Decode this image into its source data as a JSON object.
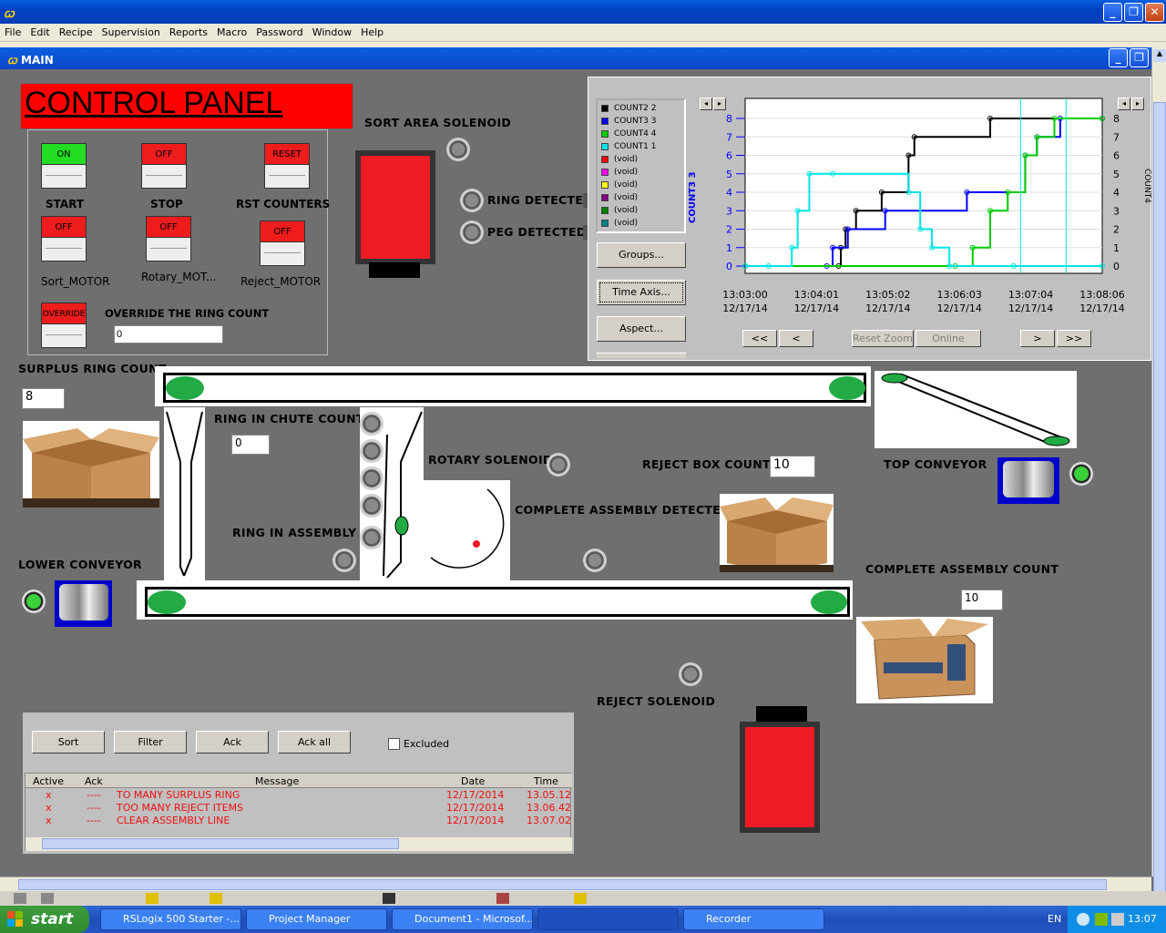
{
  "window": {
    "minimize": "_",
    "restore": "❐",
    "close": "✕"
  },
  "menu": [
    "File",
    "Edit",
    "Recipe",
    "Supervision",
    "Reports",
    "Macro",
    "Password",
    "Window",
    "Help"
  ],
  "child_window": {
    "title": "MAIN",
    "minimize": "_",
    "restore": "❐"
  },
  "control_panel": {
    "title": "CONTROL PANEL",
    "buttons": [
      {
        "state": "ON",
        "label": "START",
        "color": "#22dd22"
      },
      {
        "state": "OFF",
        "label": "STOP",
        "color": "#ee1c1c"
      },
      {
        "state": "RESET",
        "label": "RST COUNTERS",
        "color": "#ee1c1c"
      },
      {
        "state": "OFF",
        "label": "Sort_MOTOR",
        "color": "#ee1c1c"
      },
      {
        "state": "OFF",
        "label": "Rotary_MOT...",
        "color": "#ee1c1c"
      },
      {
        "state": "OFF",
        "label": "Reject_MOTOR",
        "color": "#ee1c1c"
      },
      {
        "state": "OVERRIDE",
        "label": "",
        "color": "#ee1c1c"
      }
    ],
    "override_label": "OVERRIDE THE RING COUNT",
    "override_value": "0"
  },
  "labels": {
    "sort_area_solenoid": "SORT AREA SOLENOID",
    "ring_detected": "RING DETECTED",
    "peg_detected": "PEG DETECTED",
    "surplus_ring_count": "SURPLUS RING COUNT",
    "ring_in_chute_count": "RING IN CHUTE COUNT",
    "rotary_solenoid": "ROTARY SOLENOID",
    "reject_box_count": "REJECT BOX COUNT",
    "top_conveyor": "TOP CONVEYOR",
    "complete_assembly_detected": "COMPLETE ASSEMBLY DETECTED",
    "ring_in_assembly": "RING IN ASSEMBLY",
    "lower_conveyor": "LOWER CONVEYOR",
    "complete_assembly_count": "COMPLETE ASSEMBLY COUNT",
    "reject_solenoid": "REJECT SOLENOID"
  },
  "values": {
    "surplus_ring_count": "8",
    "ring_in_chute_count": "0",
    "reject_box_count": "10",
    "complete_assembly_count": "10"
  },
  "trend": {
    "legend": [
      {
        "name": "COUNT2 2",
        "color": "#000000"
      },
      {
        "name": "COUNT3 3",
        "color": "#0000ff"
      },
      {
        "name": "COUNT4 4",
        "color": "#00cc00"
      },
      {
        "name": "COUNT1 1",
        "color": "#00e5e5"
      },
      {
        "name": "(void)",
        "color": "#ff0000"
      },
      {
        "name": "(void)",
        "color": "#ff00ff"
      },
      {
        "name": "(void)",
        "color": "#ffff00"
      },
      {
        "name": "(void)",
        "color": "#800080"
      },
      {
        "name": "(void)",
        "color": "#008000"
      },
      {
        "name": "(void)",
        "color": "#008080"
      }
    ],
    "buttons": {
      "groups": "Groups...",
      "time_axis": "Time Axis...",
      "aspect": "Aspect..."
    },
    "axis_title": "COUNT3 3",
    "right_axis_title": "COUNT4",
    "nav": {
      "first": "<<",
      "prev": "<",
      "reset_zoom": "Reset Zoom",
      "online": "Online",
      "next": ">",
      "last": ">>"
    },
    "scroll_left": "◂",
    "scroll_right": "▸"
  },
  "chart_data": {
    "type": "line",
    "ylim": [
      0,
      8
    ],
    "y_ticks": [
      "0",
      "1",
      "2",
      "3",
      "4",
      "5",
      "6",
      "7",
      "8"
    ],
    "right_y_ticks": [
      "0",
      "1",
      "2",
      "3",
      "4",
      "5",
      "6",
      "7",
      "8"
    ],
    "x_ticks": [
      {
        "time": "13:03:00",
        "date": "12/17/14"
      },
      {
        "time": "13:04:01",
        "date": "12/17/14"
      },
      {
        "time": "13:05:02",
        "date": "12/17/14"
      },
      {
        "time": "13:06:03",
        "date": "12/17/14"
      },
      {
        "time": "13:07:04",
        "date": "12/17/14"
      },
      {
        "time": "13:08:06",
        "date": "12/17/14"
      }
    ],
    "xlim": [
      0,
      306
    ],
    "series": [
      {
        "name": "COUNT2 2",
        "color": "#000000",
        "points": [
          [
            0,
            0
          ],
          [
            80,
            0
          ],
          [
            82,
            1
          ],
          [
            86,
            2
          ],
          [
            95,
            3
          ],
          [
            117,
            4
          ],
          [
            140,
            6
          ],
          [
            145,
            7
          ],
          [
            210,
            8
          ],
          [
            306,
            8
          ]
        ]
      },
      {
        "name": "COUNT3 3",
        "color": "#0000ff",
        "points": [
          [
            0,
            0
          ],
          [
            70,
            0
          ],
          [
            75,
            1
          ],
          [
            88,
            2
          ],
          [
            120,
            3
          ],
          [
            190,
            4
          ],
          [
            240,
            6
          ],
          [
            250,
            7
          ],
          [
            270,
            8
          ],
          [
            306,
            8
          ]
        ]
      },
      {
        "name": "COUNT4 4",
        "color": "#00cc00",
        "points": [
          [
            0,
            0
          ],
          [
            180,
            0
          ],
          [
            195,
            1
          ],
          [
            210,
            3
          ],
          [
            225,
            4
          ],
          [
            240,
            6
          ],
          [
            250,
            7
          ],
          [
            265,
            8
          ],
          [
            306,
            8
          ]
        ]
      },
      {
        "name": "COUNT1 1",
        "color": "#00e5e5",
        "points": [
          [
            0,
            0
          ],
          [
            20,
            0
          ],
          [
            40,
            1
          ],
          [
            45,
            3
          ],
          [
            55,
            5
          ],
          [
            75,
            5
          ],
          [
            140,
            4
          ],
          [
            150,
            2
          ],
          [
            160,
            1
          ],
          [
            175,
            0
          ],
          [
            230,
            0
          ],
          [
            306,
            0
          ]
        ]
      }
    ]
  },
  "alarms": {
    "buttons": [
      "Sort",
      "Filter",
      "Ack",
      "Ack all"
    ],
    "excluded_label": "Excluded",
    "columns": [
      "Active",
      "Ack",
      "Message",
      "Date",
      "Time"
    ],
    "rows": [
      {
        "active": "x",
        "ack": "----",
        "message": "TO MANY SURPLUS RING",
        "date": "12/17/2014",
        "time": "13.05.12"
      },
      {
        "active": "x",
        "ack": "----",
        "message": "TOO MANY REJECT ITEMS",
        "date": "12/17/2014",
        "time": "13.06.42"
      },
      {
        "active": "x",
        "ack": "----",
        "message": "CLEAR ASSEMBLY LINE",
        "date": "12/17/2014",
        "time": "13.07.02"
      }
    ]
  },
  "taskbar": {
    "start": "start",
    "tasks": [
      "RSLogix 500 Starter -...",
      "Project Manager",
      "Document1 - Microsof...",
      "",
      "Recorder"
    ],
    "lang": "EN",
    "clock": "13:07"
  }
}
